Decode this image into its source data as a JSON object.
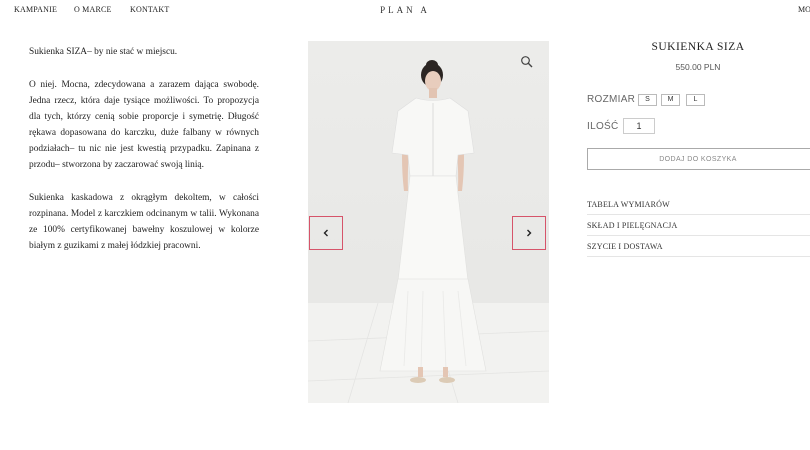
{
  "nav": {
    "links": [
      "KAMPANIE",
      "O MARCE",
      "KONTAKT"
    ],
    "brand": "PLAN A",
    "right_partial": "MO"
  },
  "description": {
    "paragraphs": [
      "Sukienka SIZA– by nie stać w miejscu.",
      "O niej. Mocna, zdecydowana a zarazem dająca swobodę. Jedna rzecz, która daje tysiące możliwości. To propozycja dla tych, którzy cenią sobie proporcje i symetrię. Długość rękawa dopasowana do karczku, duże falbany w równych podziałach– tu nic nie jest kwestią przypadku. Zapinana z przodu– stworzona by zaczarować swoją linią.",
      "Sukienka kaskadowa z okrągłym dekoltem, w całości rozpinana. Model z karczkiem odcinanym w talii. Wykonana ze 100% certyfikowanej bawełny koszulowej w kolorze białym z guzikami z małej łódzkiej pracowni."
    ]
  },
  "gallery": {
    "zoom_icon": "magnifier-icon",
    "prev_icon": "chevron-left-icon",
    "next_icon": "chevron-right-icon",
    "arrow_border_color": "#d6546a"
  },
  "product": {
    "title": "SUKIENKA SIZA",
    "price": "550.00 PLN",
    "size_label": "ROZMIAR",
    "sizes": [
      "S",
      "M",
      "L"
    ],
    "qty_label": "ILOŚĆ",
    "qty_value": "1",
    "add_to_cart": "DODAJ DO KOSZYKA",
    "accordion": [
      "TABELA WYMIARÓW",
      "SKŁAD I PIELĘGNACJA",
      "SZYCIE I DOSTAWA"
    ]
  }
}
